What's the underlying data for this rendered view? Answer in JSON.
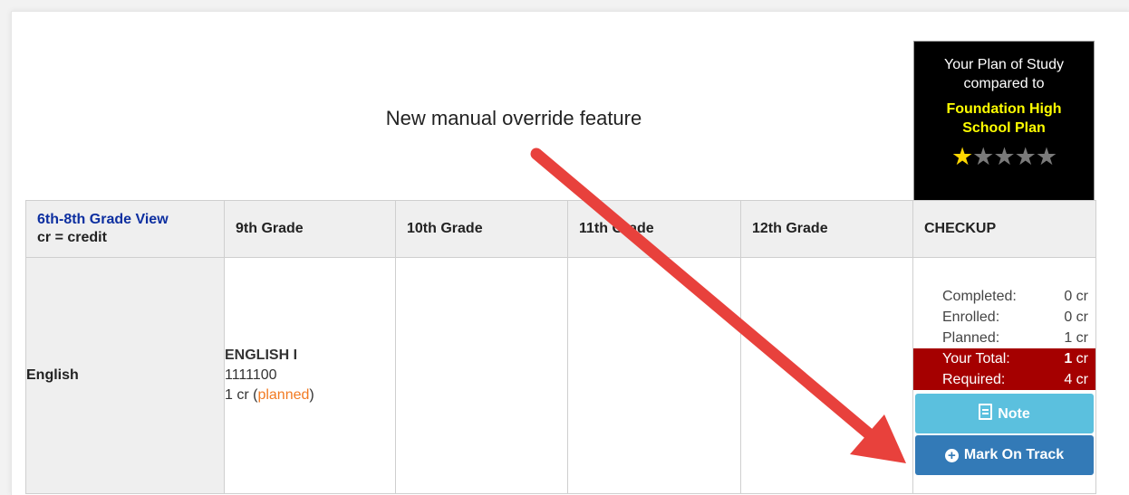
{
  "annotation": "New manual override feature",
  "plan": {
    "line1": "Your Plan of Study",
    "line2": "compared to",
    "name": "Foundation High School Plan",
    "rating": 1,
    "rating_max": 5
  },
  "table": {
    "view_link": "6th-8th Grade View",
    "view_sub": "cr = credit",
    "headers": [
      "9th Grade",
      "10th Grade",
      "11th Grade",
      "12th Grade",
      "CHECKUP"
    ],
    "rows": [
      {
        "subject": "English",
        "course": {
          "title": "ENGLISH I",
          "code": "1111100",
          "credit": "1 cr",
          "status": "planned"
        },
        "checkup": {
          "completed_label": "Completed:",
          "completed_value": "0 cr",
          "enrolled_label": "Enrolled:",
          "enrolled_value": "0 cr",
          "planned_label": "Planned:",
          "planned_value": "1 cr",
          "total_label": "Your Total:",
          "total_num": "1",
          "total_unit": "cr",
          "required_label": "Required:",
          "required_value": "4 cr"
        }
      }
    ]
  },
  "buttons": {
    "note": "Note",
    "mark_on_track": "Mark On Track"
  },
  "colors": {
    "accent_red": "#a50000",
    "note_button": "#5bc0de",
    "track_button": "#337ab7",
    "planned_text": "#f27a22",
    "plan_name": "#ffff00",
    "arrow": "#e8413c"
  }
}
